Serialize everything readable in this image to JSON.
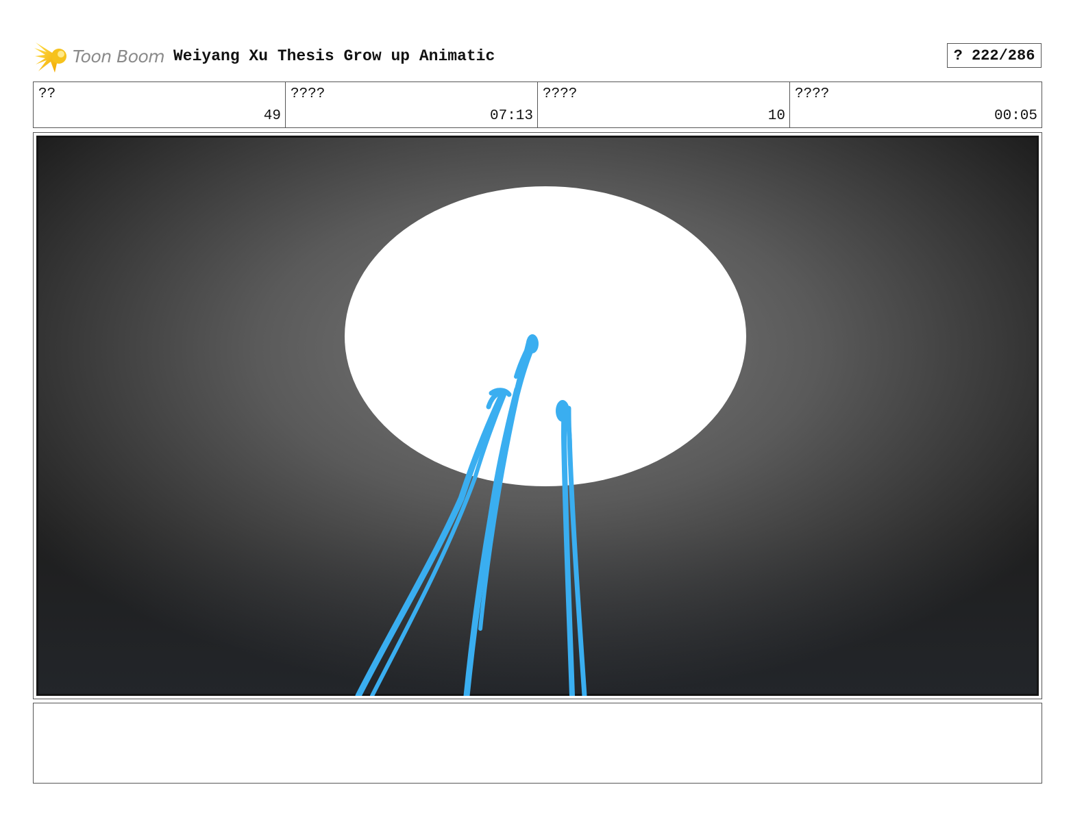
{
  "header": {
    "logo_text": "Toon Boom",
    "project_title": "Weiyang Xu Thesis Grow up Animatic",
    "page_counter": "? 222/286"
  },
  "info_fields": [
    {
      "label": "??",
      "value": "49"
    },
    {
      "label": "????",
      "value": "07:13"
    },
    {
      "label": "????",
      "value": "10"
    },
    {
      "label": "????",
      "value": "00:05"
    }
  ],
  "panel": {
    "background_center_color": "#7a7a7a",
    "background_edge_color": "#1e1e1e",
    "light_color": "#ffffff",
    "sketch_color": "#3aaef0"
  },
  "notes": {
    "text": ""
  }
}
